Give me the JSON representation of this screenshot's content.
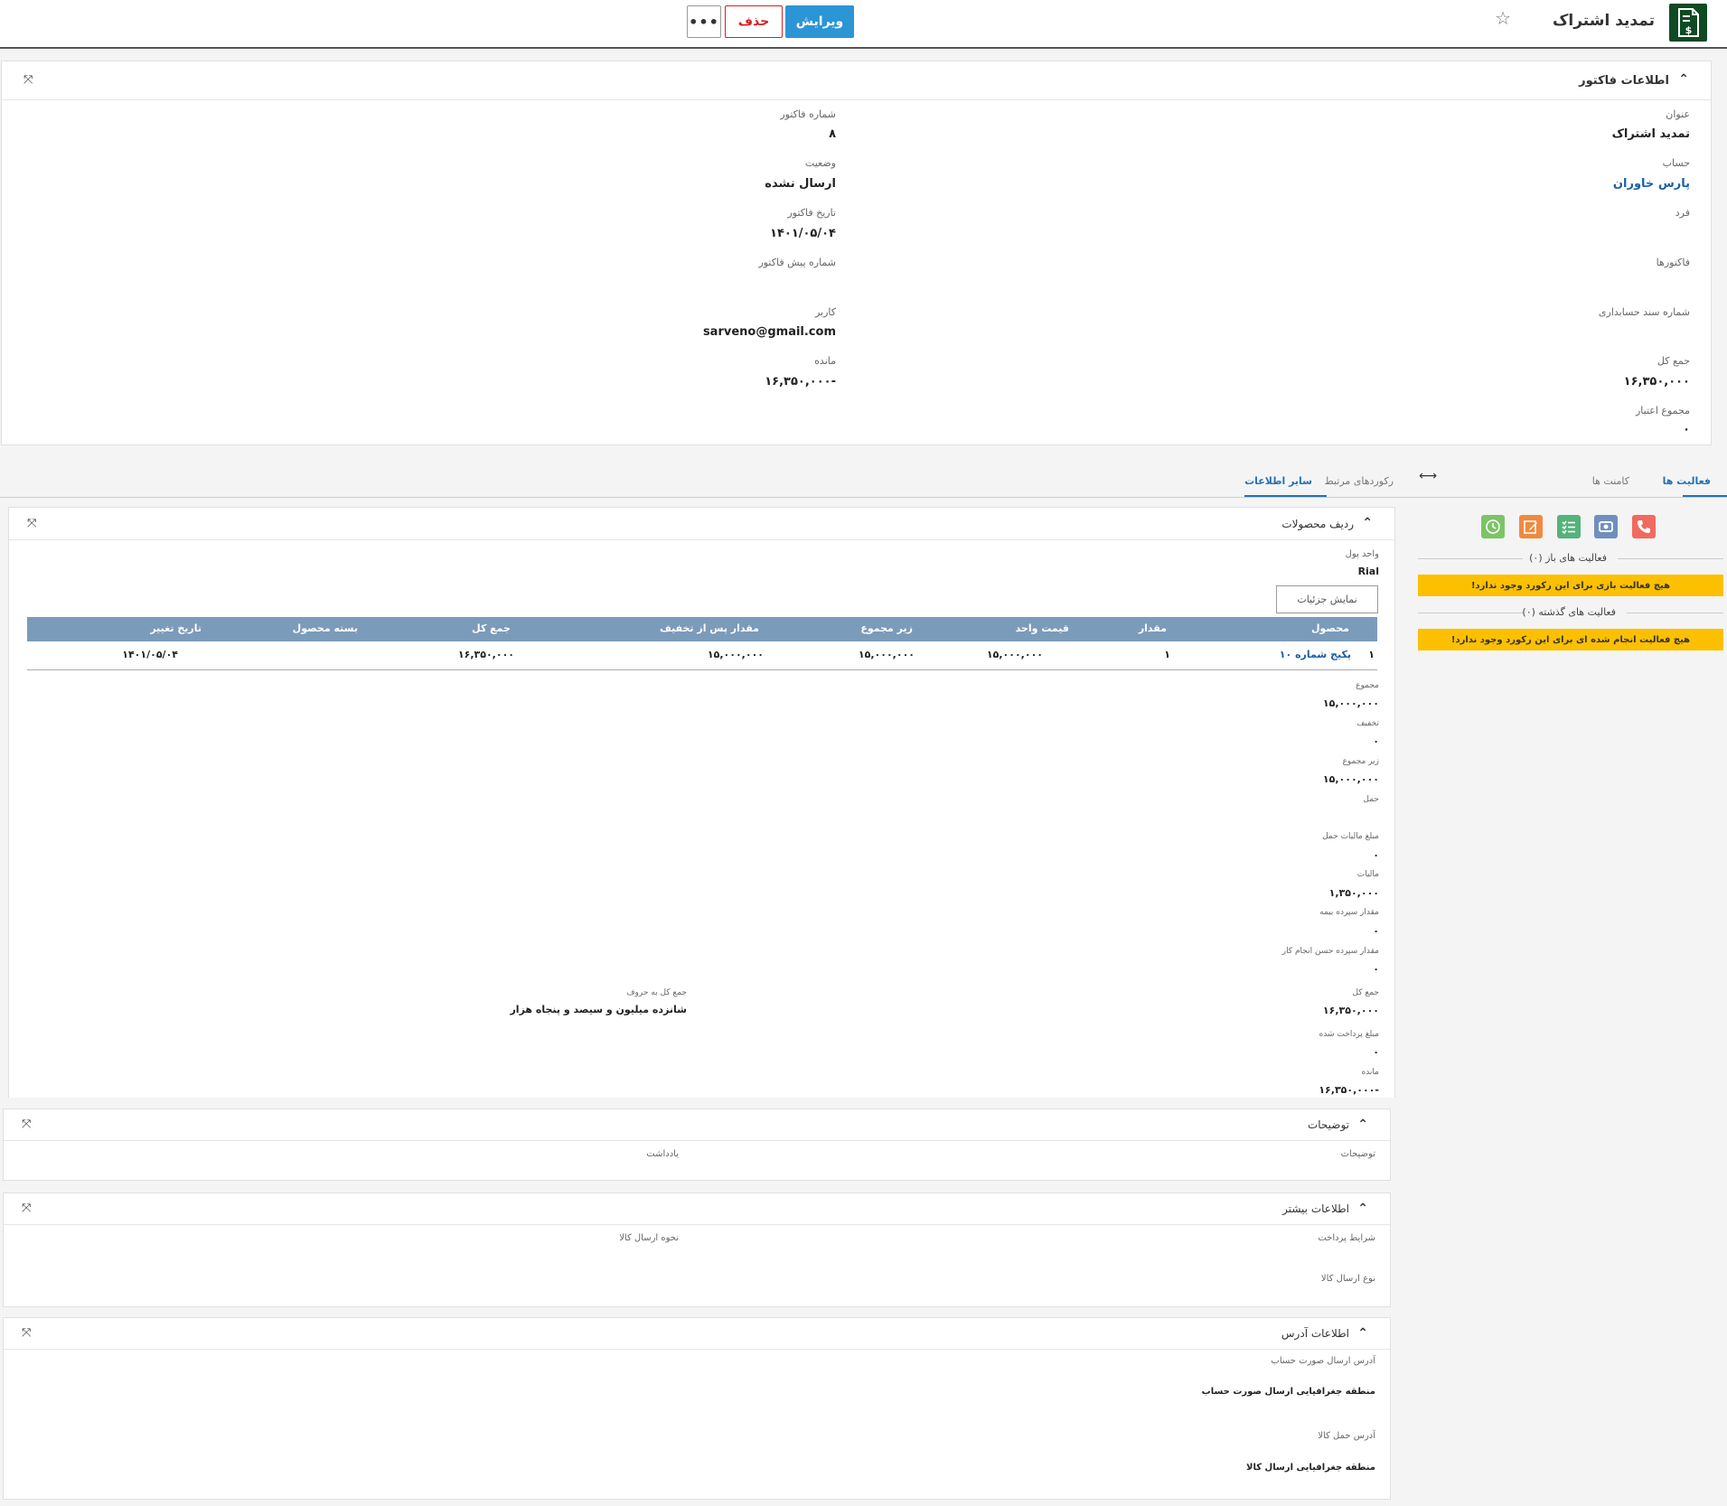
{
  "header": {
    "title": "تمدید اشتراک",
    "edit_label": "ویرایش",
    "delete_label": "حذف",
    "more_label": "•••"
  },
  "invoice_info": {
    "section_title": "اطلاعات فاکتور",
    "title_label": "عنوان",
    "title_value": "تمدید اشتراک",
    "account_label": "حساب",
    "account_value": "پارس خاوران",
    "person_label": "فرد",
    "invoices_label": "فاکتورها",
    "acc_doc_label": "شماره سند حسابداری",
    "total_label": "جمع کل",
    "total_value": "۱۶,۳۵۰,۰۰۰",
    "credit_label": "مجموع اعتبار",
    "credit_value": "۰",
    "invoice_no_label": "شماره فاکتور",
    "invoice_no_value": "۸",
    "status_label": "وضعیت",
    "status_value": "ارسال نشده",
    "date_label": "تاریخ فاکتور",
    "date_value": "۱۴۰۱/۰۵/۰۴",
    "proforma_label": "شماره پیش فاکتور",
    "user_label": "کاربر",
    "user_value": "sarveno@gmail.com",
    "remain_label": "مانده",
    "remain_value": "-۱۶,۳۵۰,۰۰۰"
  },
  "tabs": {
    "activities": "فعالیت ها",
    "comments": "کامنت ها",
    "related": "رکوردهای مرتبط",
    "other_info": "سایر اطلاعات"
  },
  "activity": {
    "open_label": "فعالیت های باز (۰)",
    "open_empty": "هیچ فعالیت بازی برای این رکورد وجود ندارد!",
    "past_label": "فعالیت های گذشته (۰)",
    "past_empty": "هیچ فعالیت انجام شده ای برای این رکورد وجود ندارد!",
    "icon_colors": {
      "phone": "#f06a5e",
      "meeting": "#6f8fbf",
      "task": "#54b37a",
      "note": "#f08a3e",
      "reminder": "#7cc466"
    }
  },
  "products": {
    "section_title": "ردیف محصولات",
    "currency_label": "واحد پول",
    "currency_value": "Rial",
    "details_button": "نمایش جزئیات",
    "columns": [
      "محصول",
      "مقدار",
      "قیمت واحد",
      "زیر مجموع",
      "مقدار پس از تخفیف",
      "جمع کل",
      "بسته محصول",
      "تاریخ تغییر"
    ],
    "rows": [
      {
        "index": "۱",
        "product": "پکیج شماره ۱۰",
        "qty": "۱",
        "unit_price": "۱۵,۰۰۰,۰۰۰",
        "subtotal": "۱۵,۰۰۰,۰۰۰",
        "after_discount": "۱۵,۰۰۰,۰۰۰",
        "total": "۱۶,۳۵۰,۰۰۰",
        "package": "",
        "changed": "۱۴۰۱/۰۵/۰۴"
      }
    ],
    "summary": {
      "sum_label": "مجموع",
      "sum_value": "۱۵,۰۰۰,۰۰۰",
      "discount_label": "تخفیف",
      "discount_value": "۰",
      "subtotal_label": "زیر مجموع",
      "subtotal_value": "۱۵,۰۰۰,۰۰۰",
      "shipping_label": "حمل",
      "shipping_tax_label": "مبلغ مالیات حمل",
      "shipping_tax_value": "۰",
      "tax_label": "مالیات",
      "tax_value": "۱,۳۵۰,۰۰۰",
      "insurance_label": "مقدار سپرده بیمه",
      "insurance_value": "۰",
      "performance_label": "مقدار سپرده حسن انجام کار",
      "performance_value": "۰",
      "total_label": "جمع کل",
      "total_value": "۱۶,۳۵۰,۰۰۰",
      "paid_label": "مبلغ پرداخت شده",
      "paid_value": "۰",
      "remain_label": "مانده",
      "remain_value": "-۱۶,۳۵۰,۰۰۰",
      "words_label": "جمع کل به حروف",
      "words_value": "شانزده میلیون و سیصد و پنجاه هزار"
    }
  },
  "descriptions": {
    "section_title": "توضیحات",
    "desc_label": "توضیحات",
    "note_label": "یادداشت"
  },
  "more_info": {
    "section_title": "اطلاعات بیشتر",
    "payment_terms_label": "شرایط پرداخت",
    "delivery_method_label": "نحوه ارسال کالا",
    "shipping_type_label": "نوع ارسال کالا"
  },
  "address": {
    "section_title": "اطلاعات آدرس",
    "billing_address_label": "آدرس ارسال صورت حساب",
    "billing_region": "منطقه جغرافیایی ارسال صورت حساب",
    "shipping_address_label": "آدرس حمل کالا",
    "shipping_region": "منطقه جغرافیایی ارسال کالا"
  }
}
